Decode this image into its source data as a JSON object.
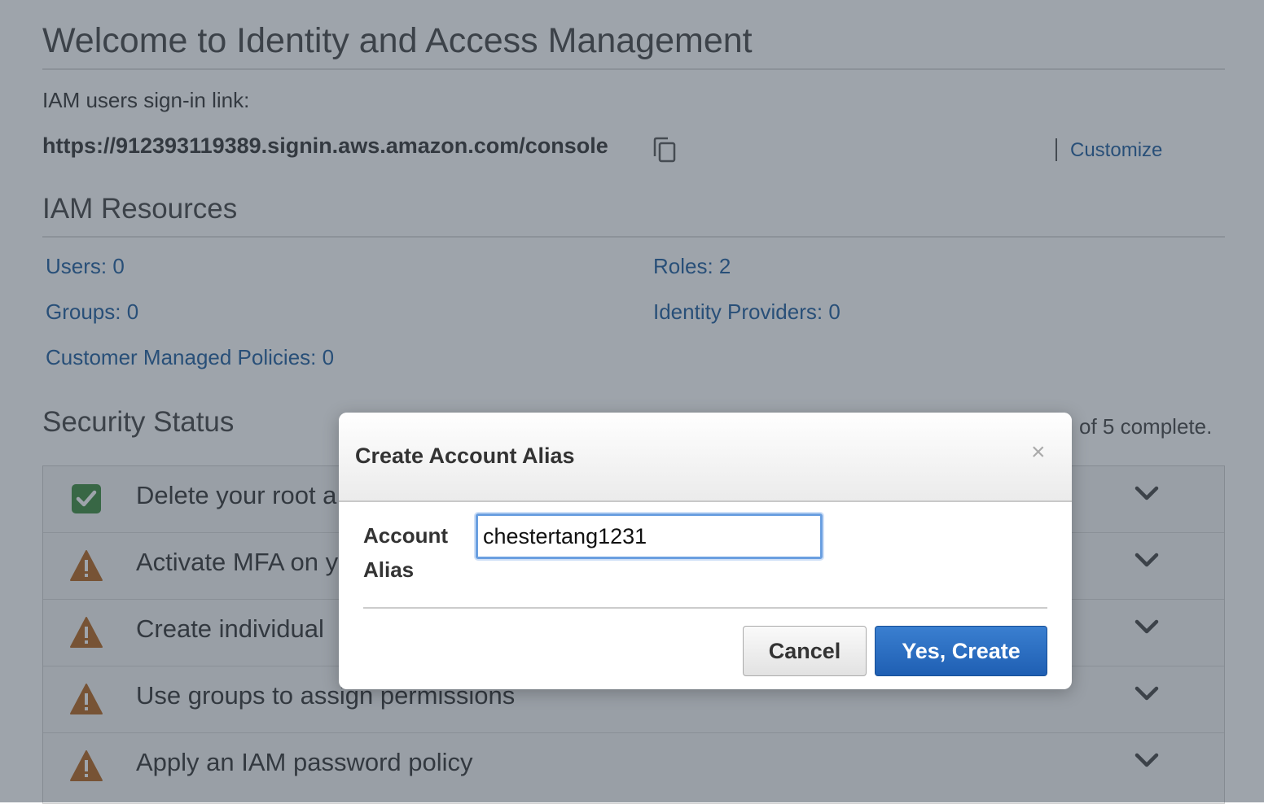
{
  "page": {
    "title": "Welcome to Identity and Access Management",
    "signin_label": "IAM users sign-in link:",
    "signin_url": "https://912393119389.signin.aws.amazon.com/console",
    "copy_icon": "copy-icon",
    "customize_label": "Customize"
  },
  "resources": {
    "heading": "IAM Resources",
    "users": "Users: 0",
    "roles": "Roles: 2",
    "groups": "Groups: 0",
    "identity_providers": "Identity Providers: 0",
    "customer_policies": "Customer Managed Policies: 0"
  },
  "security": {
    "heading": "Security Status",
    "progress_visible": "of 5 complete.",
    "items": [
      {
        "label": "Delete your root a",
        "status": "complete",
        "icon": "check-icon"
      },
      {
        "label": "Activate MFA on y",
        "status": "warning",
        "icon": "warning-icon"
      },
      {
        "label": "Create individual",
        "status": "warning",
        "icon": "warning-icon"
      },
      {
        "label": "Use groups to assign permissions",
        "status": "warning",
        "icon": "warning-icon"
      },
      {
        "label": "Apply an IAM password policy",
        "status": "warning",
        "icon": "warning-icon"
      }
    ]
  },
  "modal": {
    "title": "Create Account Alias",
    "close_glyph": "×",
    "field_label": "Account Alias",
    "field_value": "chestertang1231",
    "cancel_label": "Cancel",
    "create_label": "Yes, Create"
  },
  "colors": {
    "link": "#1e5c9e",
    "warning": "#b5651d",
    "success": "#3d8b3d",
    "primary_button": "#2a6cc4"
  }
}
